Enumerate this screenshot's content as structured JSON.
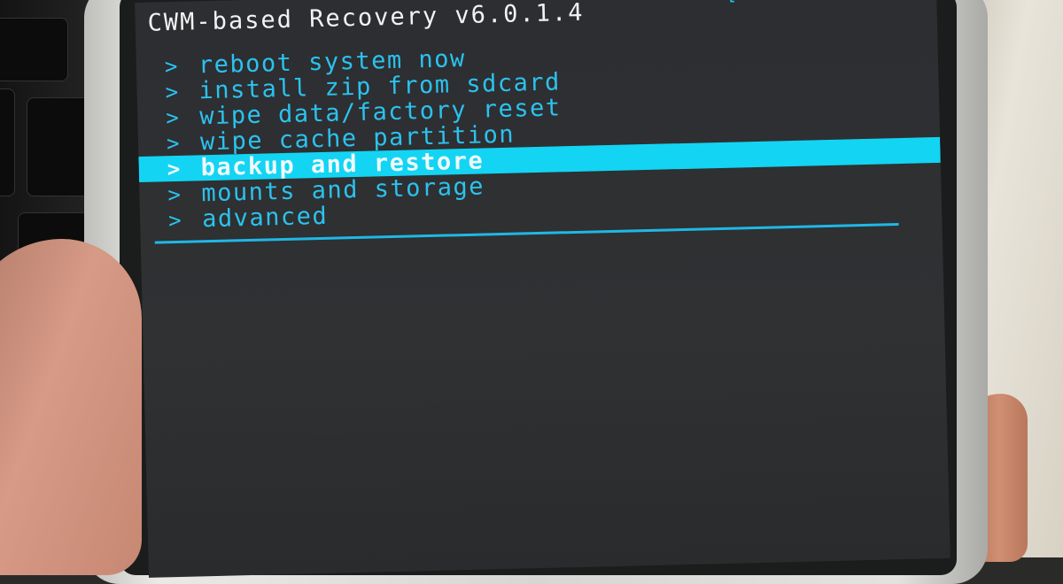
{
  "recovery": {
    "title": "CWM-based Recovery v6.0.1.4",
    "status_text": "[..............]",
    "accent_color": "#13d4f3",
    "text_color": "#2bc2ee",
    "menu": [
      {
        "label": "reboot system now",
        "chevron": ">"
      },
      {
        "label": "install zip from sdcard",
        "chevron": ">"
      },
      {
        "label": "wipe data/factory reset",
        "chevron": ">"
      },
      {
        "label": "wipe cache partition",
        "chevron": ">"
      },
      {
        "label": "backup and restore",
        "chevron": ">",
        "selected": true
      },
      {
        "label": "mounts and storage",
        "chevron": ">"
      },
      {
        "label": "advanced",
        "chevron": ">"
      }
    ]
  }
}
